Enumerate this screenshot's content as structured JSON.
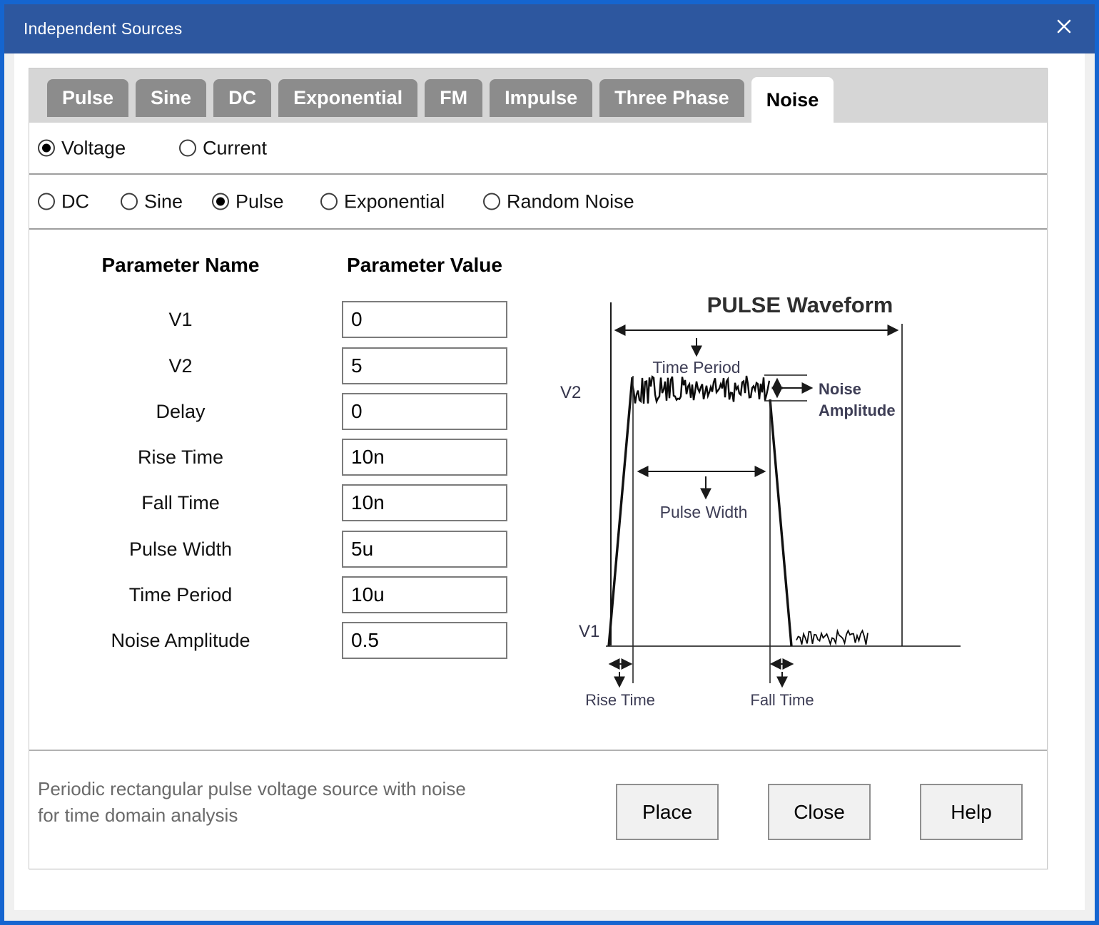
{
  "window": {
    "title": "Independent Sources"
  },
  "icons": {
    "close": "close-x"
  },
  "tabs": [
    {
      "label": "Pulse",
      "active": false
    },
    {
      "label": "Sine",
      "active": false
    },
    {
      "label": "DC",
      "active": false
    },
    {
      "label": "Exponential",
      "active": false
    },
    {
      "label": "FM",
      "active": false
    },
    {
      "label": "Impulse",
      "active": false
    },
    {
      "label": "Three Phase",
      "active": false
    },
    {
      "label": "Noise",
      "active": true
    }
  ],
  "source_kind": {
    "options": [
      {
        "label": "Voltage",
        "selected": true
      },
      {
        "label": "Current",
        "selected": false
      }
    ]
  },
  "signal_type": {
    "options": [
      {
        "label": "DC",
        "selected": false
      },
      {
        "label": "Sine",
        "selected": false
      },
      {
        "label": "Pulse",
        "selected": true
      },
      {
        "label": "Exponential",
        "selected": false
      },
      {
        "label": "Random Noise",
        "selected": false
      }
    ]
  },
  "parameters": {
    "name_header": "Parameter Name",
    "value_header": "Parameter Value",
    "rows": [
      {
        "name": "V1",
        "value": "0"
      },
      {
        "name": "V2",
        "value": "5"
      },
      {
        "name": "Delay",
        "value": "0"
      },
      {
        "name": "Rise Time",
        "value": "10n"
      },
      {
        "name": "Fall Time",
        "value": "10n"
      },
      {
        "name": "Pulse Width",
        "value": "5u"
      },
      {
        "name": "Time Period",
        "value": "10u"
      },
      {
        "name": "Noise Amplitude",
        "value": "0.5"
      }
    ]
  },
  "diagram": {
    "title": "PULSE Waveform",
    "v2_label": "V2",
    "v1_label": "V1",
    "time_period_label": "Time Period",
    "pulse_width_label": "Pulse Width",
    "rise_time_label": "Rise Time",
    "fall_time_label": "Fall Time",
    "noise_amp_label_line1": "Noise",
    "noise_amp_label_line2": "Amplitude"
  },
  "footer": {
    "description_line1": "Periodic rectangular pulse voltage source with noise",
    "description_line2": "for time domain analysis",
    "place_button": "Place",
    "close_button": "Close",
    "help_button": "Help"
  },
  "colors": {
    "window_border": "#1565d0",
    "title_bar": "#2d579f",
    "tab_strip": "#d6d6d6",
    "tab_inactive": "#8c8c8c",
    "separator": "#9e9e9e",
    "description_text": "#6a6a6a"
  }
}
